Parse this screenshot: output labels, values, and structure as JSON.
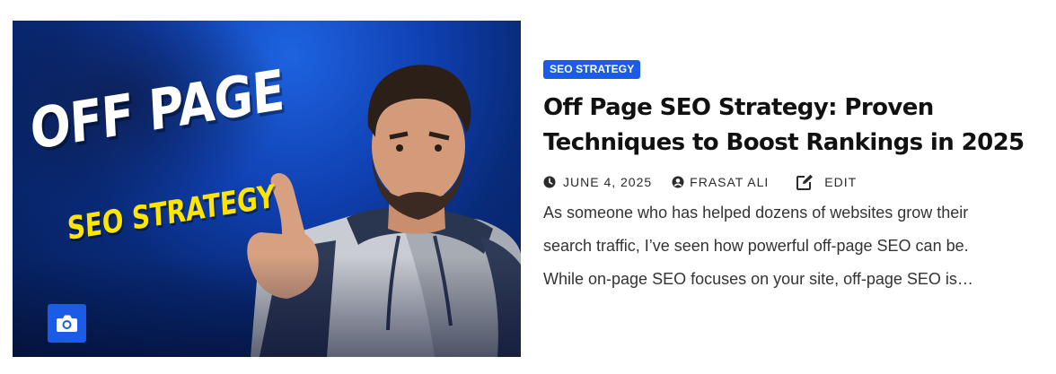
{
  "post": {
    "thumbnail": {
      "headline": "OFF PAGE",
      "subline": "SEO STRATEGY",
      "badge_icon": "camera-icon",
      "accent_color": "#1a5ce8",
      "subline_color": "#ffe600"
    },
    "category": "SEO STRATEGY",
    "title": "Off Page SEO Strategy: Proven Techniques to Boost Rankings in 2025",
    "meta": {
      "date_icon": "clock-icon",
      "date": "JUNE 4, 2025",
      "author_icon": "user-icon",
      "author": "FRASAT ALI",
      "edit_icon": "edit-icon",
      "edit_label": "EDIT"
    },
    "excerpt_lines": [
      "As someone who has helped dozens of websites grow their",
      "search traffic, I’ve seen how powerful off-page SEO can be.",
      "While on-page SEO focuses on your site, off-page SEO is…"
    ]
  }
}
